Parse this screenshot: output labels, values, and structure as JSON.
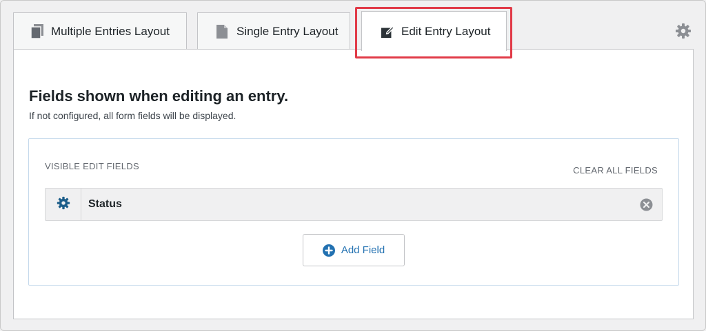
{
  "tabs": [
    {
      "label": "Multiple Entries Layout",
      "icon": "copy-icon"
    },
    {
      "label": "Single Entry Layout",
      "icon": "document-icon"
    },
    {
      "label": "Edit Entry Layout",
      "icon": "edit-icon",
      "active": true
    }
  ],
  "settings_icon": "gear-icon",
  "panel": {
    "title": "Fields shown when editing an entry.",
    "subtitle": "If not configured, all form fields will be displayed.",
    "section_label": "VISIBLE EDIT FIELDS",
    "clear_all_label": "CLEAR ALL FIELDS",
    "fields": [
      {
        "label": "Status"
      }
    ],
    "add_field_label": "Add Field"
  },
  "colors": {
    "highlight": "#e13a47",
    "accent": "#2271b1",
    "field_gear": "#1d5e8a",
    "muted_icon": "#8c8f94"
  }
}
